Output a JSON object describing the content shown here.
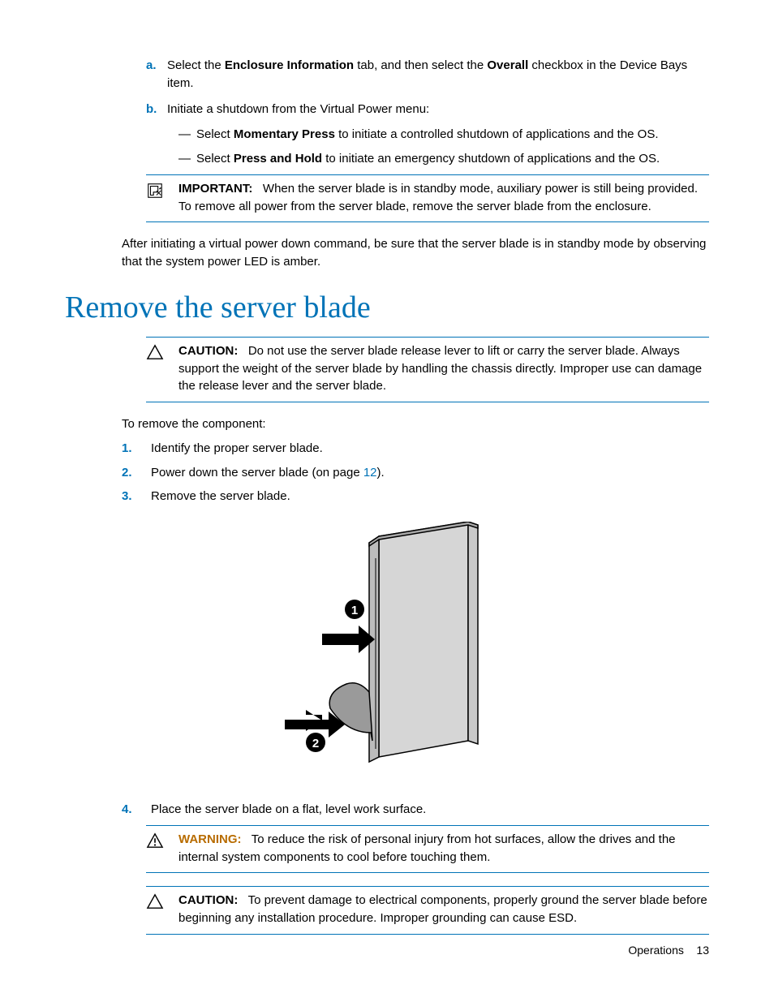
{
  "sub_a": {
    "marker": "a.",
    "pre": "Select the ",
    "bold1": "Enclosure Information",
    "mid": " tab, and then select the ",
    "bold2": "Overall",
    "post": " checkbox in the Device Bays item."
  },
  "sub_b": {
    "marker": "b.",
    "text": "Initiate a shutdown from the Virtual Power menu:"
  },
  "dash1": {
    "dash": "—",
    "pre": "Select ",
    "bold": "Momentary Press",
    "post": " to initiate a controlled shutdown of applications and the OS."
  },
  "dash2": {
    "dash": "—",
    "pre": "Select ",
    "bold": "Press and Hold",
    "post": " to initiate an emergency shutdown of applications and the OS."
  },
  "important": {
    "label": "IMPORTANT:",
    "text": "When the server blade is in standby mode, auxiliary power is still being provided. To remove all power from the server blade, remove the server blade from the enclosure."
  },
  "after_para": "After initiating a virtual power down command, be sure that the server blade is in standby mode by observing that the system power LED is amber.",
  "heading": "Remove the server blade",
  "caution1": {
    "label": "CAUTION:",
    "text": "Do not use the server blade release lever to lift or carry the server blade. Always support the weight of the server blade by handling the chassis directly. Improper use can damage the release lever and the server blade."
  },
  "intro": "To remove the component:",
  "step1": {
    "marker": "1.",
    "text": "Identify the proper server blade."
  },
  "step2": {
    "marker": "2.",
    "pre": "Power down the server blade (on page ",
    "link": "12",
    "post": ")."
  },
  "step3": {
    "marker": "3.",
    "text": "Remove the server blade."
  },
  "step4": {
    "marker": "4.",
    "text": "Place the server blade on a flat, level work surface."
  },
  "warning": {
    "label": "WARNING:",
    "text": "To reduce the risk of personal injury from hot surfaces, allow the drives and the internal system components to cool before touching them."
  },
  "caution2": {
    "label": "CAUTION:",
    "text": "To prevent damage to electrical components, properly ground the server blade before beginning any installation procedure. Improper grounding can cause ESD."
  },
  "diagram": {
    "callout1": "1",
    "callout2": "2"
  },
  "footer": {
    "section": "Operations",
    "page": "13"
  }
}
